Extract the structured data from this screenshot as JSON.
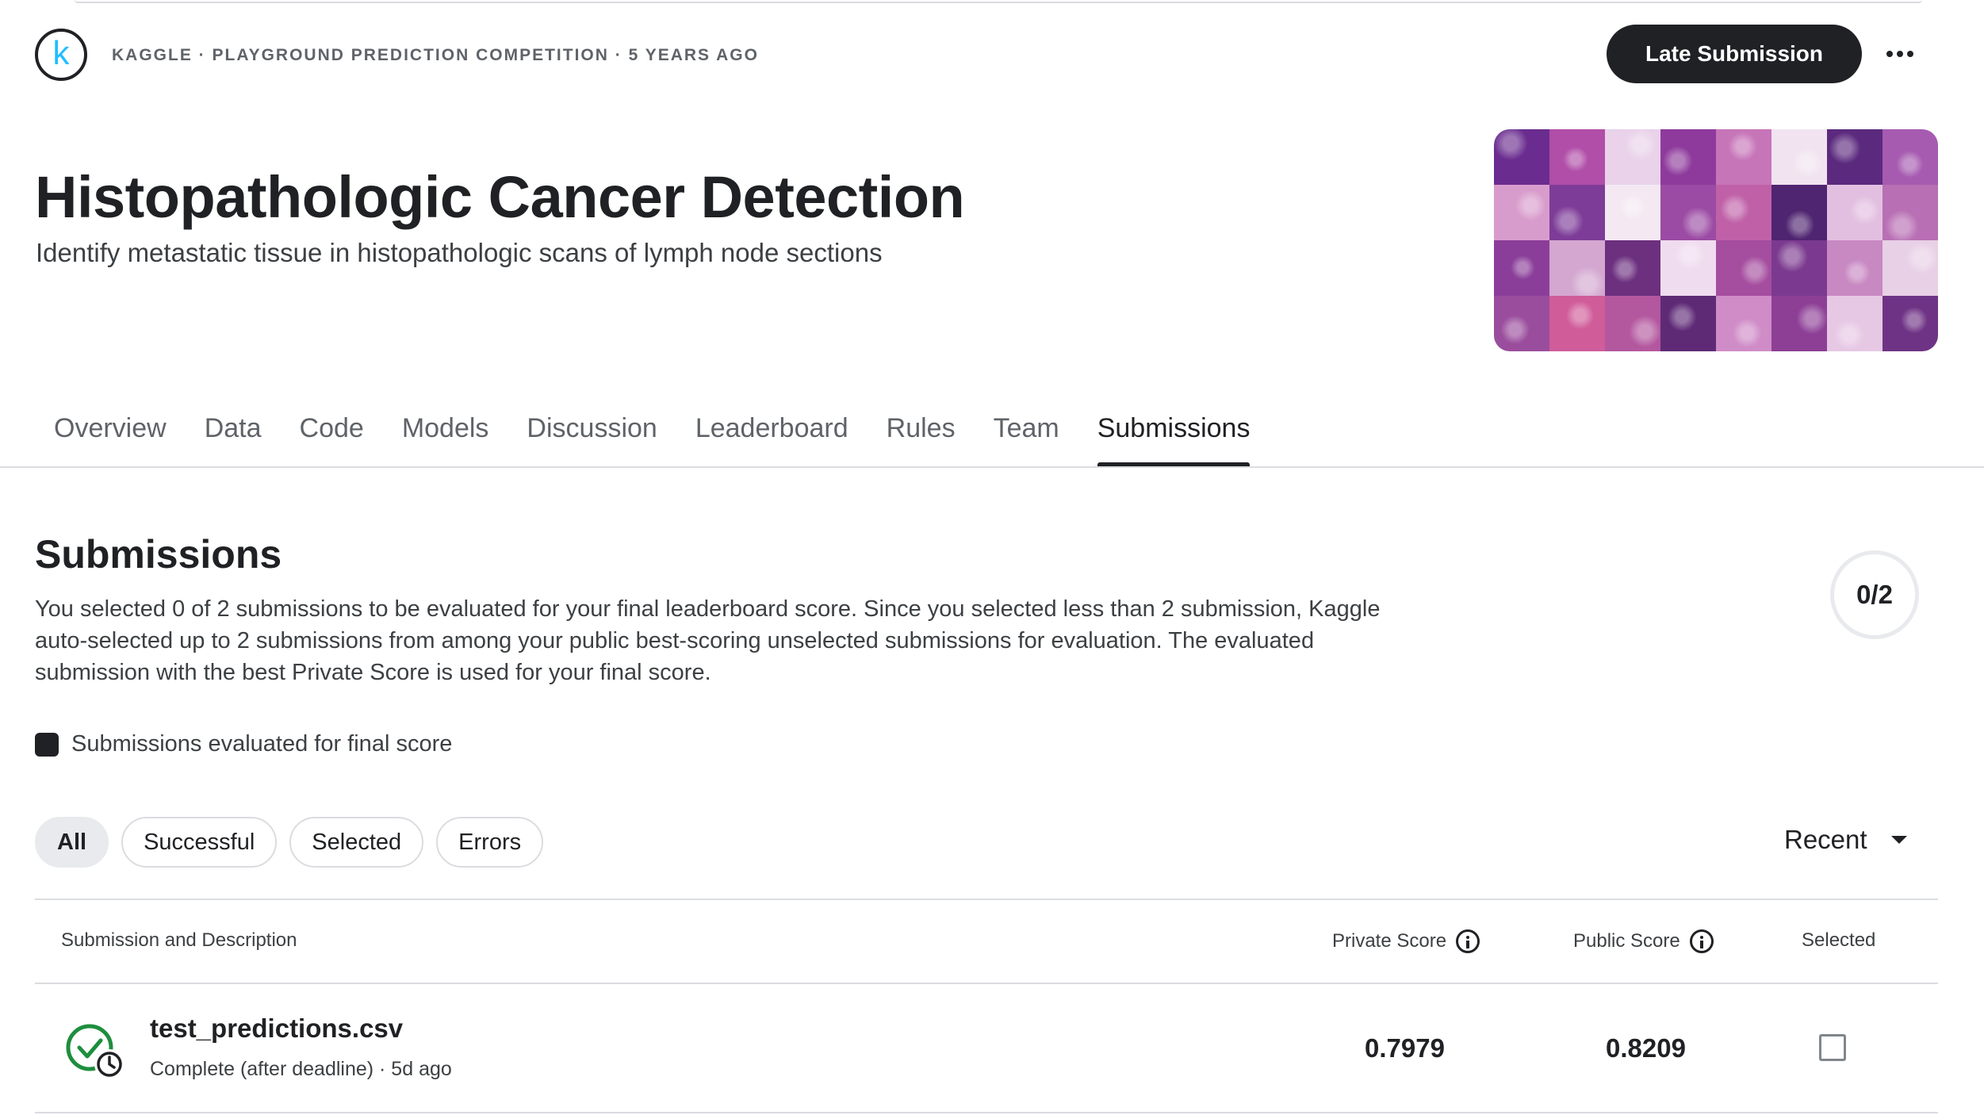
{
  "header": {
    "logo_letter": "k",
    "breadcrumb": "KAGGLE · PLAYGROUND PREDICTION COMPETITION · 5 YEARS AGO",
    "late_submission_label": "Late Submission"
  },
  "competition": {
    "title": "Histopathologic Cancer Detection",
    "subtitle": "Identify metastatic tissue in histopathologic scans of lymph node sections"
  },
  "tabs": [
    {
      "label": "Overview"
    },
    {
      "label": "Data"
    },
    {
      "label": "Code"
    },
    {
      "label": "Models"
    },
    {
      "label": "Discussion"
    },
    {
      "label": "Leaderboard"
    },
    {
      "label": "Rules"
    },
    {
      "label": "Team"
    },
    {
      "label": "Submissions",
      "active": true
    }
  ],
  "submissions": {
    "heading": "Submissions",
    "description": "You selected 0 of 2 submissions to be evaluated for your final leaderboard score. Since you selected less than 2 submission, Kaggle auto-selected up to 2 submissions from among your public best-scoring unselected submissions for evaluation. The evaluated submission with the best Private Score is used for your final score.",
    "selected_count": "0/2",
    "legend_label": "Submissions evaluated for final score",
    "filters": [
      "All",
      "Successful",
      "Selected",
      "Errors"
    ],
    "active_filter": "All",
    "sort_label": "Recent"
  },
  "table": {
    "headers": {
      "submission": "Submission and Description",
      "private_score": "Private Score",
      "public_score": "Public Score",
      "selected": "Selected"
    },
    "rows": [
      {
        "file": "test_predictions.csv",
        "status": "Complete (after deadline) · 5d ago",
        "private_score": "0.7979",
        "public_score": "0.8209",
        "selected": false
      }
    ]
  },
  "colors": {
    "primary": "#202124",
    "accent": "#20beff",
    "success": "#1e8e3e"
  }
}
